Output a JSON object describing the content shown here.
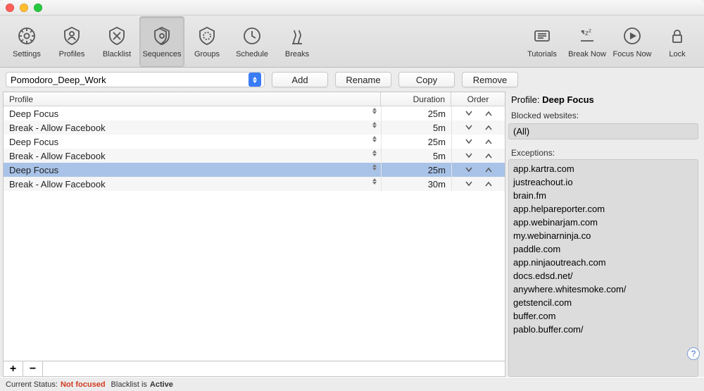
{
  "toolbar": {
    "left": [
      {
        "id": "settings",
        "label": "Settings"
      },
      {
        "id": "profiles",
        "label": "Profiles"
      },
      {
        "id": "blacklist",
        "label": "Blacklist"
      },
      {
        "id": "sequences",
        "label": "Sequences",
        "selected": true
      },
      {
        "id": "groups",
        "label": "Groups"
      },
      {
        "id": "schedule",
        "label": "Schedule"
      },
      {
        "id": "breaks",
        "label": "Breaks"
      }
    ],
    "right": [
      {
        "id": "tutorials",
        "label": "Tutorials"
      },
      {
        "id": "breaknow",
        "label": "Break Now"
      },
      {
        "id": "focusnow",
        "label": "Focus Now"
      },
      {
        "id": "lock",
        "label": "Lock"
      }
    ]
  },
  "actions": {
    "combo_value": "Pomodoro_Deep_Work",
    "add": "Add",
    "rename": "Rename",
    "copy": "Copy",
    "remove": "Remove"
  },
  "table": {
    "headers": {
      "profile": "Profile",
      "duration": "Duration",
      "order": "Order"
    },
    "rows": [
      {
        "profile": "Deep Focus",
        "duration": "25m",
        "selected": false
      },
      {
        "profile": "Break - Allow Facebook",
        "duration": "5m",
        "selected": false
      },
      {
        "profile": "Deep Focus",
        "duration": "25m",
        "selected": false
      },
      {
        "profile": "Break - Allow Facebook",
        "duration": "5m",
        "selected": false
      },
      {
        "profile": "Deep Focus",
        "duration": "25m",
        "selected": true
      },
      {
        "profile": "Break - Allow Facebook",
        "duration": "30m",
        "selected": false
      }
    ]
  },
  "side": {
    "title_prefix": "Profile: ",
    "title_name": "Deep Focus",
    "blocked_label": "Blocked websites:",
    "blocked_value": "(All)",
    "exceptions_label": "Exceptions:",
    "exceptions": [
      "app.kartra.com",
      "justreachout.io",
      "brain.fm",
      "app.helpareporter.com",
      "app.webinarjam.com",
      "my.webinarninja.co",
      "paddle.com",
      "app.ninjaoutreach.com",
      "docs.edsd.net/",
      "anywhere.whitesmoke.com/",
      "getstencil.com",
      "buffer.com",
      "pablo.buffer.com/"
    ]
  },
  "status": {
    "prefix": "Current Status:",
    "value": "Not focused",
    "bl_prefix": "Blacklist is",
    "bl_value": "Active"
  }
}
